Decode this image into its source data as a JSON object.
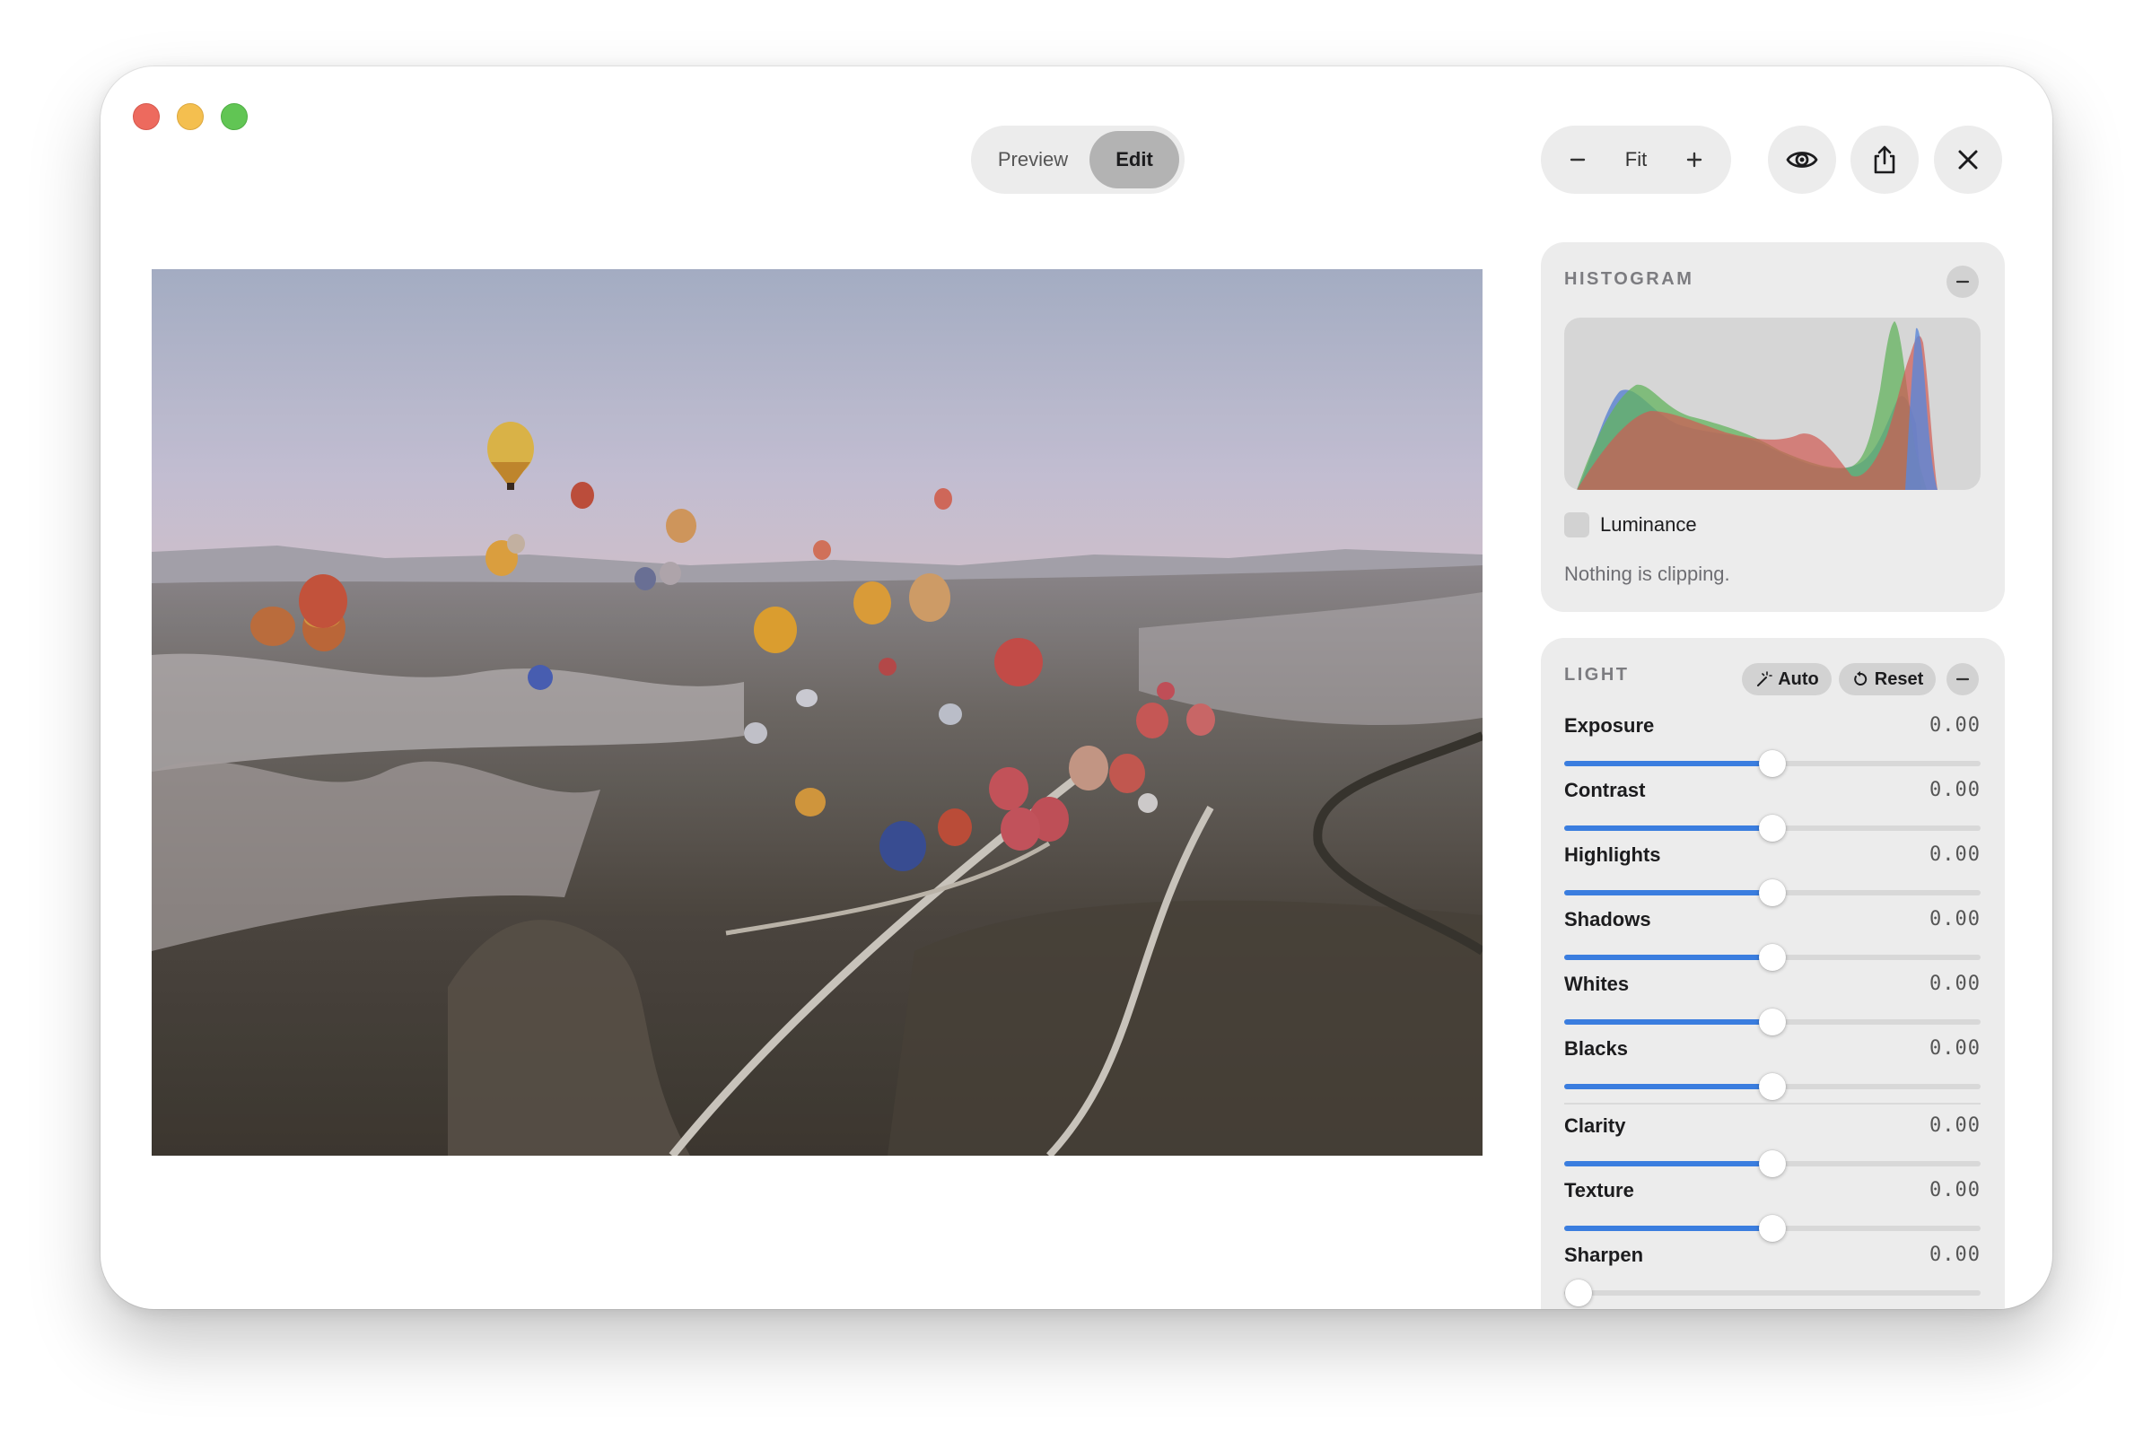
{
  "toolbar": {
    "mode_tabs": [
      {
        "label": "Preview",
        "selected": false
      },
      {
        "label": "Edit",
        "selected": true
      }
    ],
    "zoom": {
      "minus_icon": "minus-icon",
      "label": "Fit",
      "plus_icon": "plus-icon"
    },
    "icons": {
      "preview": "eye-icon",
      "share": "share-icon",
      "close": "close-icon"
    }
  },
  "photo": {
    "subject": "hot-air-balloons-over-valley-image"
  },
  "histogram": {
    "title": "HISTOGRAM",
    "luminance_label": "Luminance",
    "luminance_checked": false,
    "status": "Nothing is clipping."
  },
  "light": {
    "title": "LIGHT",
    "auto_label": "Auto",
    "reset_label": "Reset",
    "accent_color": "#3a7ddf",
    "sliders": [
      {
        "label": "Exposure",
        "value": "0.00",
        "position": 0.5
      },
      {
        "label": "Contrast",
        "value": "0.00",
        "position": 0.5
      },
      {
        "label": "Highlights",
        "value": "0.00",
        "position": 0.5
      },
      {
        "label": "Shadows",
        "value": "0.00",
        "position": 0.5
      },
      {
        "label": "Whites",
        "value": "0.00",
        "position": 0.5
      },
      {
        "label": "Blacks",
        "value": "0.00",
        "position": 0.5
      },
      {
        "label": "Clarity",
        "value": "0.00",
        "position": 0.5
      },
      {
        "label": "Texture",
        "value": "0.00",
        "position": 0.5
      },
      {
        "label": "Sharpen",
        "value": "0.00",
        "position": 0.0
      }
    ]
  }
}
